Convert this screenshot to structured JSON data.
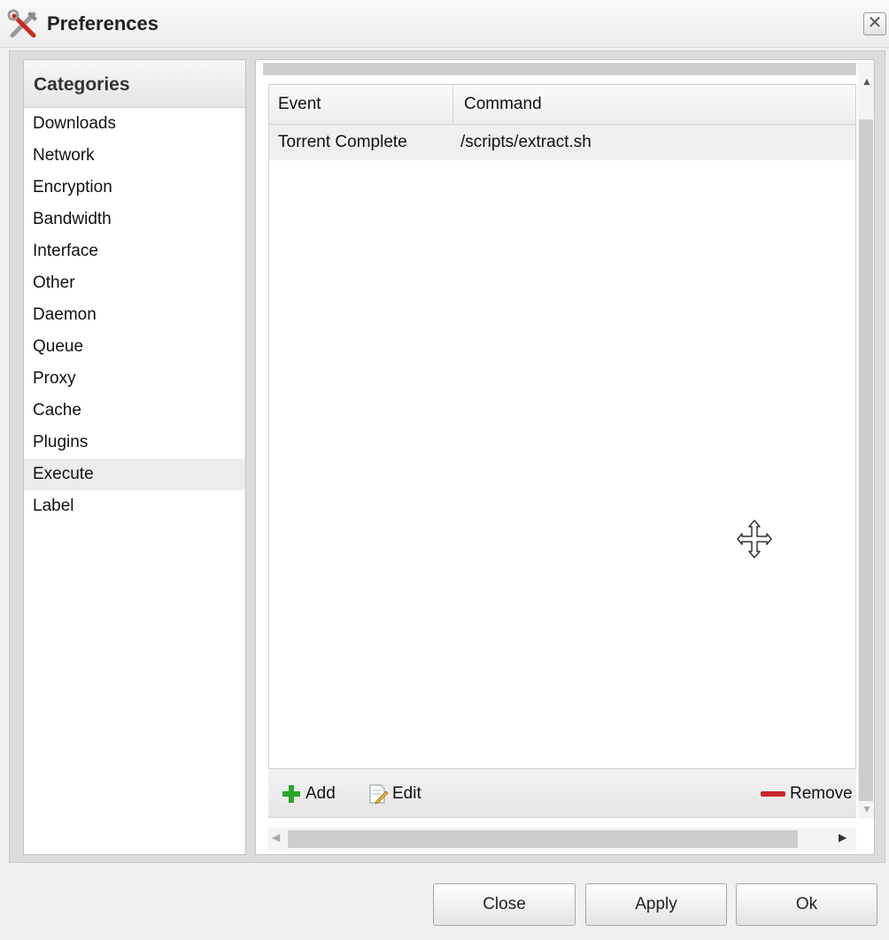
{
  "window": {
    "title": "Preferences",
    "close_glyph": "✕"
  },
  "categories": {
    "header": "Categories",
    "items": [
      {
        "label": "Downloads"
      },
      {
        "label": "Network"
      },
      {
        "label": "Encryption"
      },
      {
        "label": "Bandwidth"
      },
      {
        "label": "Interface"
      },
      {
        "label": "Other"
      },
      {
        "label": "Daemon"
      },
      {
        "label": "Queue"
      },
      {
        "label": "Proxy"
      },
      {
        "label": "Cache"
      },
      {
        "label": "Plugins"
      },
      {
        "label": "Execute",
        "selected": true
      },
      {
        "label": "Label"
      }
    ]
  },
  "execute": {
    "columns": {
      "event": "Event",
      "command": "Command"
    },
    "rows": [
      {
        "event": "Torrent Complete",
        "command": "/scripts/extract.sh"
      }
    ],
    "toolbar": {
      "add_label": "Add",
      "edit_label": "Edit",
      "remove_label": "Remove"
    }
  },
  "footer": {
    "close_label": "Close",
    "apply_label": "Apply",
    "ok_label": "Ok"
  },
  "colors": {
    "add_icon": "#2aa52a",
    "remove_icon": "#c8282d",
    "selected_row": "#ececec"
  },
  "icons": {
    "title": "tools-icon",
    "add": "plus-icon",
    "edit": "edit-icon",
    "remove": "minus-icon",
    "cursor": "move-cursor-icon"
  }
}
